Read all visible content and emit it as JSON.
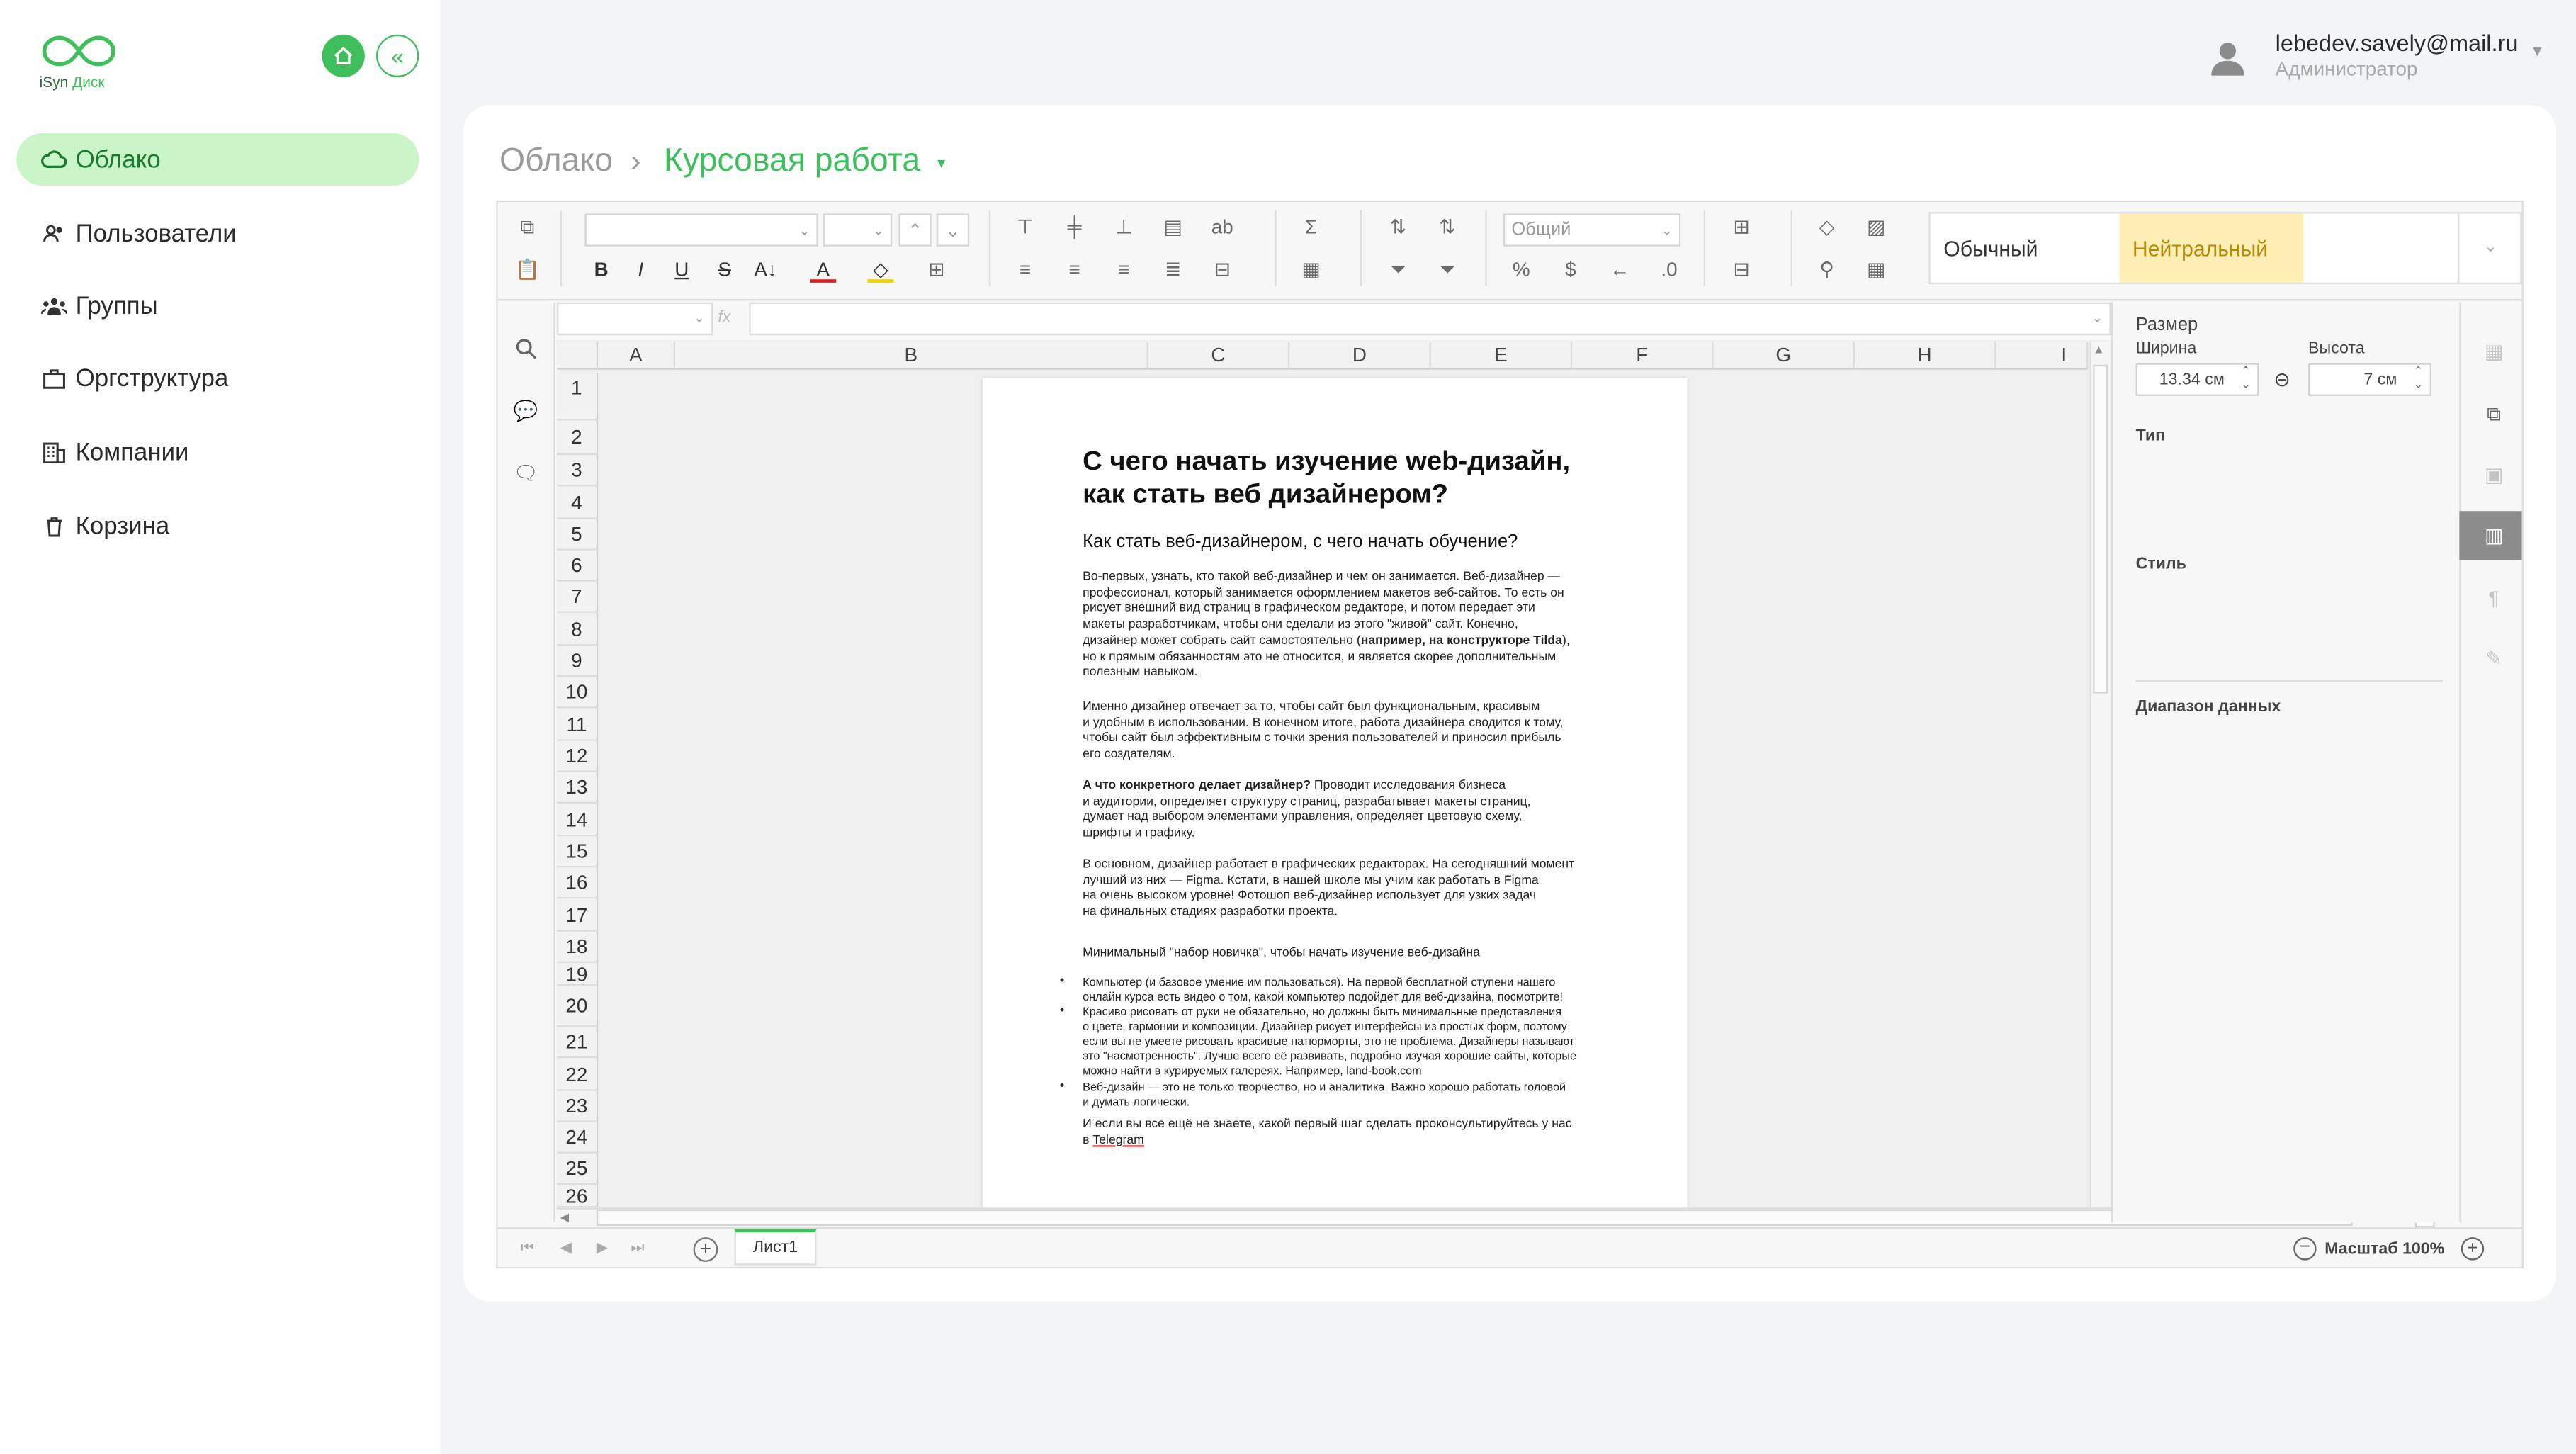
{
  "brand": {
    "name_part1": "iSyn",
    "name_part2": "Диск"
  },
  "sidebar": {
    "items": [
      {
        "label": "Облако",
        "icon": "cloud-icon",
        "active": true
      },
      {
        "label": "Пользователи",
        "icon": "users-icon"
      },
      {
        "label": "Группы",
        "icon": "group-icon"
      },
      {
        "label": "Оргструктура",
        "icon": "briefcase-icon"
      },
      {
        "label": "Компании",
        "icon": "building-icon"
      },
      {
        "label": "Корзина",
        "icon": "trash-icon"
      }
    ]
  },
  "header": {
    "email": "lebedev.savely@mail.ru",
    "role": "Администратор"
  },
  "breadcrumb": {
    "root": "Облако",
    "separator": "›",
    "current": "Курсовая работа"
  },
  "toolbar": {
    "number_format": "Общий",
    "style_normal": "Обычный",
    "style_neutral": "Нейтральный"
  },
  "formula_bar": {
    "fx": "fx"
  },
  "columns": [
    "A",
    "B",
    "C",
    "D",
    "E",
    "F",
    "G",
    "H",
    "I"
  ],
  "rows": [
    "1",
    "2",
    "3",
    "4",
    "5",
    "6",
    "7",
    "8",
    "9",
    "10",
    "11",
    "12",
    "13",
    "14",
    "15",
    "16",
    "17",
    "18",
    "19",
    "20",
    "21",
    "22",
    "23",
    "24",
    "25",
    "26"
  ],
  "document": {
    "title_line1": "С чего начать изучение web-дизайн,",
    "title_line2": "как стать веб дизайнером?",
    "subtitle": "Как стать веб-дизайнером, с чего начать обучение?",
    "p1": [
      "Во-первых, узнать, кто такой веб-дизайнер и чем он занимается. Веб-дизайнер —",
      "профессионал, который занимается оформлением макетов веб-сайтов. То есть он",
      "рисует внешний вид страниц в графическом редакторе, и потом передает эти",
      "макеты разработчикам, чтобы они сделали из этого \"живой\" сайт. Конечно,"
    ],
    "p1_l5_a": "дизайнер может собрать сайт самостоятельно (",
    "p1_l5_b": "например, на конструкторе Tilda",
    "p1_l5_c": "),",
    "p1_rest": [
      "но к прямым обязанностям это не относится, и является скорее дополнительным",
      "полезным навыком."
    ],
    "p2": [
      "Именно дизайнер отвечает за то, чтобы сайт был функциональным, красивым",
      "и удобным в использовании. В конечном итоге, работа дизайнера сводится к тому,",
      "чтобы сайт был эффективным с точки зрения пользователей и приносил прибыль",
      "его создателям."
    ],
    "p3_bold": "А что конкретного делает дизайнер?",
    "p3_l1": " Проводит исследования бизнеса",
    "p3_rest": [
      "и аудитории, определяет структуру страниц, разрабатывает макеты страниц,",
      "думает над выбором элементами управления, определяет цветовую схему,",
      "шрифты и графику."
    ],
    "p4": [
      "В основном, дизайнер работает в графических редакторах. На сегодняшний момент",
      "лучший из них — Figma. Кстати, в нашей школе мы учим как работать в Figma",
      "на очень высоком уровне! Фотошоп веб-дизайнер использует для узких задач",
      "на финальных стадиях разработки проекта."
    ],
    "p5": "Минимальный \"набор новичка\", чтобы начать изучение веб-дизайна",
    "list": [
      [
        "Компьютер (и базовое умение им пользоваться). На первой бесплатной ступени нашего",
        "онлайн курса есть видео о том, какой компьютер подойдёт для веб-дизайна, посмотрите!"
      ],
      [
        "Красиво рисовать от руки не обязательно, но должны быть минимальные представления",
        "о цвете, гармонии и композиции. Дизайнер рисует интерфейсы из простых форм, поэтому",
        "если вы не умеете рисовать красивые натюрморты, это не проблема. Дизайнеры называют",
        "это \"насмотренность\". Лучше всего её развивать, подробно изучая хорошие сайты, которые",
        "можно найти в курируемых галереях. Например, land-book.com"
      ],
      [
        "Веб-дизайн — это не только творчество, но и аналитика. Важно хорошо работать головой",
        "и думать логически."
      ]
    ],
    "final_l1": "И если вы все ещё не знаете, какой первый шаг сделать проконсультируйтесь у нас",
    "final_l2_a": "в ",
    "final_link": "Telegram"
  },
  "right_panel": {
    "size_label": "Размер",
    "width_label": "Ширина",
    "height_label": "Высота",
    "width_value": "13.34 см",
    "height_value": "7 см",
    "type_label": "Тип",
    "style_label": "Стиль",
    "range_label": "Диапазон данных"
  },
  "sheets": {
    "tab": "Лист1",
    "zoom": "Масштаб 100%"
  },
  "colors": {
    "accent": "#3fbf5c",
    "active_bg": "#c9f5c9",
    "neutral_style": "#fdeeb3"
  }
}
